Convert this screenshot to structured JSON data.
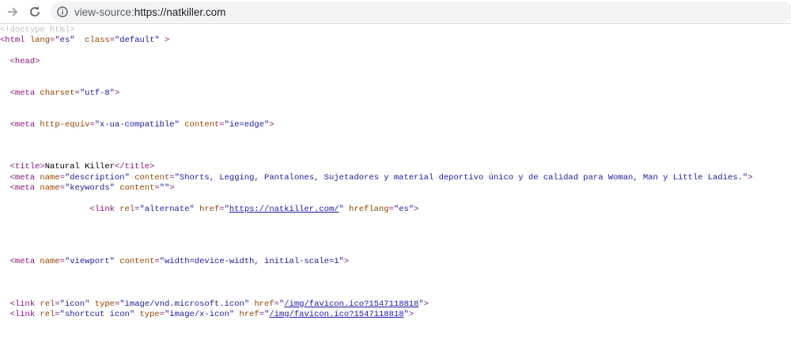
{
  "browser": {
    "url_scheme": "view-source:",
    "url_host": "https://natkiller.com",
    "icons": [
      "forward-arrow-icon",
      "reload-icon",
      "info-icon"
    ]
  },
  "colors": {
    "tag": "#881280",
    "attr": "#994500",
    "value": "#1a1aa6",
    "comment": "#c0c0c0"
  },
  "source_lines": [
    [
      [
        "comment",
        "<!doctype html>"
      ]
    ],
    [
      [
        "tag",
        "<html "
      ],
      [
        "attr",
        "lang"
      ],
      [
        "tag",
        "="
      ],
      [
        "val",
        "\"es\""
      ],
      [
        "text",
        "  "
      ],
      [
        "attr",
        "class"
      ],
      [
        "tag",
        "="
      ],
      [
        "val",
        "\"default\""
      ],
      [
        "tag",
        " >"
      ]
    ],
    [],
    [
      [
        "text",
        "  "
      ],
      [
        "tag",
        "<head>"
      ]
    ],
    [],
    [],
    [
      [
        "text",
        "  "
      ],
      [
        "tag",
        "<meta "
      ],
      [
        "attr",
        "charset"
      ],
      [
        "tag",
        "="
      ],
      [
        "val",
        "\"utf-8\""
      ],
      [
        "tag",
        ">"
      ]
    ],
    [],
    [],
    [
      [
        "text",
        "  "
      ],
      [
        "tag",
        "<meta "
      ],
      [
        "attr",
        "http-equiv"
      ],
      [
        "tag",
        "="
      ],
      [
        "val",
        "\"x-ua-compatible\""
      ],
      [
        "text",
        " "
      ],
      [
        "attr",
        "content"
      ],
      [
        "tag",
        "="
      ],
      [
        "val",
        "\"ie=edge\""
      ],
      [
        "tag",
        ">"
      ]
    ],
    [],
    [],
    [],
    [
      [
        "text",
        "  "
      ],
      [
        "tag",
        "<title>"
      ],
      [
        "text",
        "Natural Killer"
      ],
      [
        "tag",
        "</title>"
      ]
    ],
    [
      [
        "text",
        "  "
      ],
      [
        "tag",
        "<meta "
      ],
      [
        "attr",
        "name"
      ],
      [
        "tag",
        "="
      ],
      [
        "val",
        "\"description\""
      ],
      [
        "text",
        " "
      ],
      [
        "attr",
        "content"
      ],
      [
        "tag",
        "="
      ],
      [
        "val",
        "\"Shorts, Legging, Pantalones, Sujetadores y material deportivo único y de calidad para Woman, Man y Little Ladies.\""
      ],
      [
        "tag",
        ">"
      ]
    ],
    [
      [
        "text",
        "  "
      ],
      [
        "tag",
        "<meta "
      ],
      [
        "attr",
        "name"
      ],
      [
        "tag",
        "="
      ],
      [
        "val",
        "\"keywords\""
      ],
      [
        "text",
        " "
      ],
      [
        "attr",
        "content"
      ],
      [
        "tag",
        "="
      ],
      [
        "val",
        "\"\""
      ],
      [
        "tag",
        ">"
      ]
    ],
    [],
    [
      [
        "text",
        "                  "
      ],
      [
        "tag",
        "<link "
      ],
      [
        "attr",
        "rel"
      ],
      [
        "tag",
        "="
      ],
      [
        "val",
        "\"alternate\""
      ],
      [
        "text",
        " "
      ],
      [
        "attr",
        "href"
      ],
      [
        "tag",
        "="
      ],
      [
        "val",
        "\""
      ],
      [
        "link",
        "https://natkiller.com/"
      ],
      [
        "val",
        "\""
      ],
      [
        "text",
        " "
      ],
      [
        "attr",
        "hreflang"
      ],
      [
        "tag",
        "="
      ],
      [
        "val",
        "\"es\""
      ],
      [
        "tag",
        ">"
      ]
    ],
    [],
    [],
    [],
    [],
    [
      [
        "text",
        "  "
      ],
      [
        "tag",
        "<meta "
      ],
      [
        "attr",
        "name"
      ],
      [
        "tag",
        "="
      ],
      [
        "val",
        "\"viewport\""
      ],
      [
        "text",
        " "
      ],
      [
        "attr",
        "content"
      ],
      [
        "tag",
        "="
      ],
      [
        "val",
        "\"width=device-width, initial-scale=1\""
      ],
      [
        "tag",
        ">"
      ]
    ],
    [],
    [],
    [],
    [
      [
        "text",
        "  "
      ],
      [
        "tag",
        "<link "
      ],
      [
        "attr",
        "rel"
      ],
      [
        "tag",
        "="
      ],
      [
        "val",
        "\"icon\""
      ],
      [
        "text",
        " "
      ],
      [
        "attr",
        "type"
      ],
      [
        "tag",
        "="
      ],
      [
        "val",
        "\"image/vnd.microsoft.icon\""
      ],
      [
        "text",
        " "
      ],
      [
        "attr",
        "href"
      ],
      [
        "tag",
        "="
      ],
      [
        "val",
        "\""
      ],
      [
        "link",
        "/img/favicon.ico?1547118818"
      ],
      [
        "val",
        "\""
      ],
      [
        "tag",
        ">"
      ]
    ],
    [
      [
        "text",
        "  "
      ],
      [
        "tag",
        "<link "
      ],
      [
        "attr",
        "rel"
      ],
      [
        "tag",
        "="
      ],
      [
        "val",
        "\"shortcut icon\""
      ],
      [
        "text",
        " "
      ],
      [
        "attr",
        "type"
      ],
      [
        "tag",
        "="
      ],
      [
        "val",
        "\"image/x-icon\""
      ],
      [
        "text",
        " "
      ],
      [
        "attr",
        "href"
      ],
      [
        "tag",
        "="
      ],
      [
        "val",
        "\""
      ],
      [
        "link",
        "/img/favicon.ico?1547118818"
      ],
      [
        "val",
        "\""
      ],
      [
        "tag",
        ">"
      ]
    ]
  ]
}
